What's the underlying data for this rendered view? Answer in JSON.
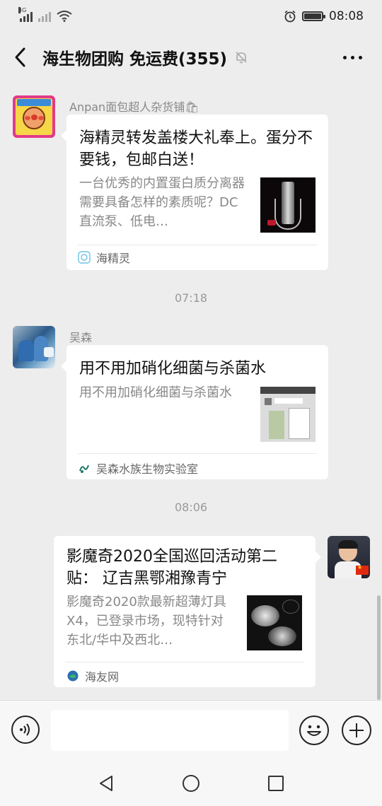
{
  "status_bar": {
    "network_tag": "4G",
    "time": "08:08",
    "icons": [
      "signal-icon",
      "signal-icon",
      "wifi-icon",
      "alarm-icon",
      "battery-icon"
    ]
  },
  "header": {
    "title": "海生物团购  免运费(355)",
    "icons": [
      "back-icon",
      "mute-icon",
      "more-icon"
    ]
  },
  "messages": [
    {
      "sender": "Anpan面包超人杂货铺🛍",
      "card": {
        "title": "海精灵转发盖楼大礼奉上。蛋分不要钱，包邮白送！",
        "desc": "一台优秀的内置蛋白质分离器需要具备怎样的素质呢？DC直流泵、低电…",
        "source": "海精灵"
      }
    },
    {
      "time": "07:18"
    },
    {
      "sender": "吴森",
      "card": {
        "title": "用不用加硝化细菌与杀菌水",
        "desc": "用不用加硝化细菌与杀菌水",
        "source": "吴森水族生物实验室"
      }
    },
    {
      "time": "08:06"
    },
    {
      "sender": "",
      "card": {
        "title": "影魔奇2020全国巡回活动第二贴： 辽吉黑鄂湘豫青宁",
        "desc": "影魔奇2020款最新超薄灯具X4，已登录市场，现特针对东北/华中及西北…",
        "source": "海友网"
      }
    }
  ],
  "input_bar": {
    "placeholder": "",
    "icons": [
      "voice-icon",
      "emoji-icon",
      "plus-icon"
    ]
  },
  "system_nav": {
    "icons": [
      "nav-back-icon",
      "nav-home-icon",
      "nav-recent-icon"
    ]
  },
  "colors": {
    "background": "#ededed",
    "card": "#ffffff",
    "title_text": "#111111",
    "secondary_text": "#888888"
  }
}
